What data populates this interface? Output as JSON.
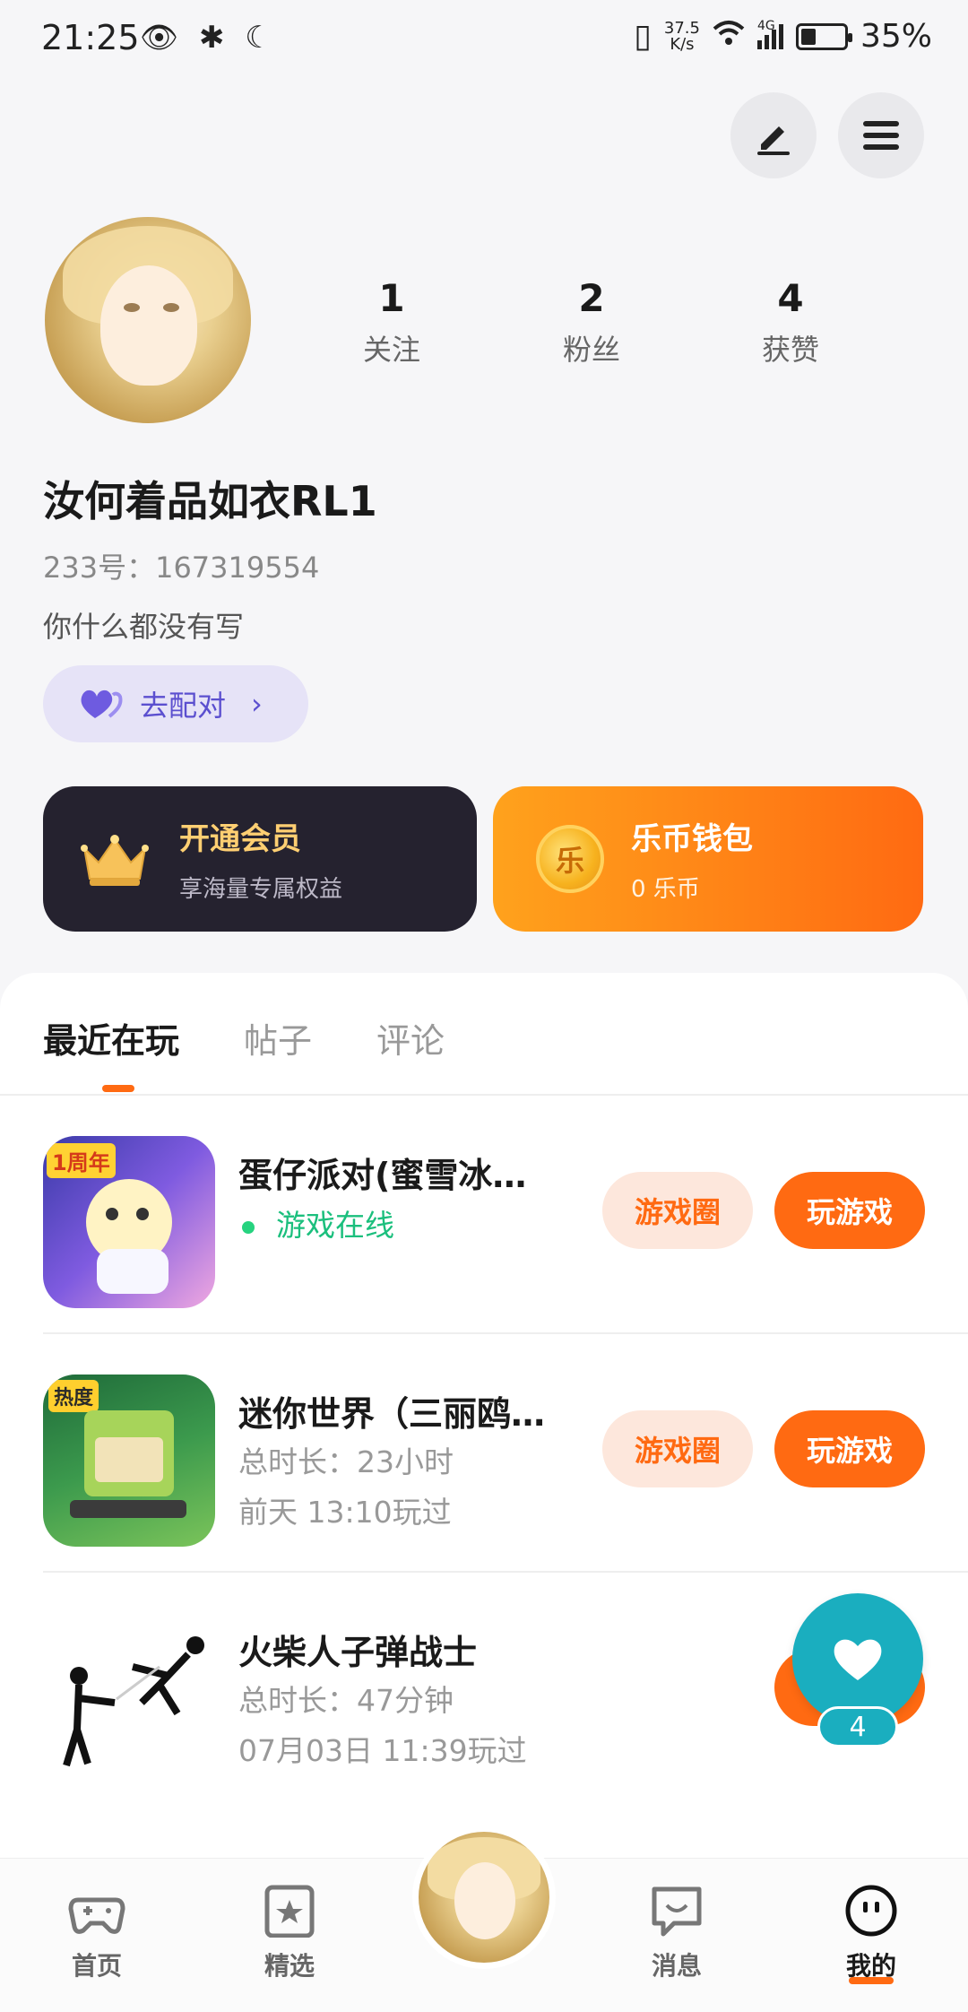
{
  "status_bar": {
    "time": "21:25",
    "left_icons": "👁 ✱ ☾",
    "net_speed_value": "37.5",
    "net_speed_unit": "K/s",
    "signal_label": "4G",
    "battery": "35%"
  },
  "profile": {
    "stats": [
      {
        "num": "1",
        "label": "关注"
      },
      {
        "num": "2",
        "label": "粉丝"
      },
      {
        "num": "4",
        "label": "获赞"
      }
    ],
    "username": "汝何着品如衣RL1",
    "uid": "233号：167319554",
    "bio": "你什么都没有写",
    "match_button": "去配对"
  },
  "cards": {
    "vip_title": "开通会员",
    "vip_sub": "享海量专属权益",
    "wallet_title": "乐币钱包",
    "wallet_sub": "0 乐币",
    "coin_char": "乐"
  },
  "tabs": [
    "最近在玩",
    "帖子",
    "评论"
  ],
  "games": [
    {
      "name": "蛋仔派对(蜜雪冰…",
      "status": "游戏在线",
      "circle_btn": "游戏圈",
      "play_btn": "玩游戏"
    },
    {
      "name": "迷你世界（三丽鸥…",
      "duration": "总时长：23小时",
      "last_played": "前天 13:10玩过",
      "circle_btn": "游戏圈",
      "play_btn": "玩游戏"
    },
    {
      "name": "火柴人子弹战士",
      "duration": "总时长：47分钟",
      "last_played": "07月03日 11:39玩过"
    }
  ],
  "like_fab": {
    "count": "4"
  },
  "bottom_nav": [
    {
      "label": "首页"
    },
    {
      "label": "精选"
    },
    {
      "label": "消息"
    },
    {
      "label": "我的"
    }
  ],
  "colors": {
    "accent": "#ff6a12",
    "online": "#1bbf7d",
    "match_purple": "#5b4fcf",
    "fab_teal": "#1aaebf"
  }
}
